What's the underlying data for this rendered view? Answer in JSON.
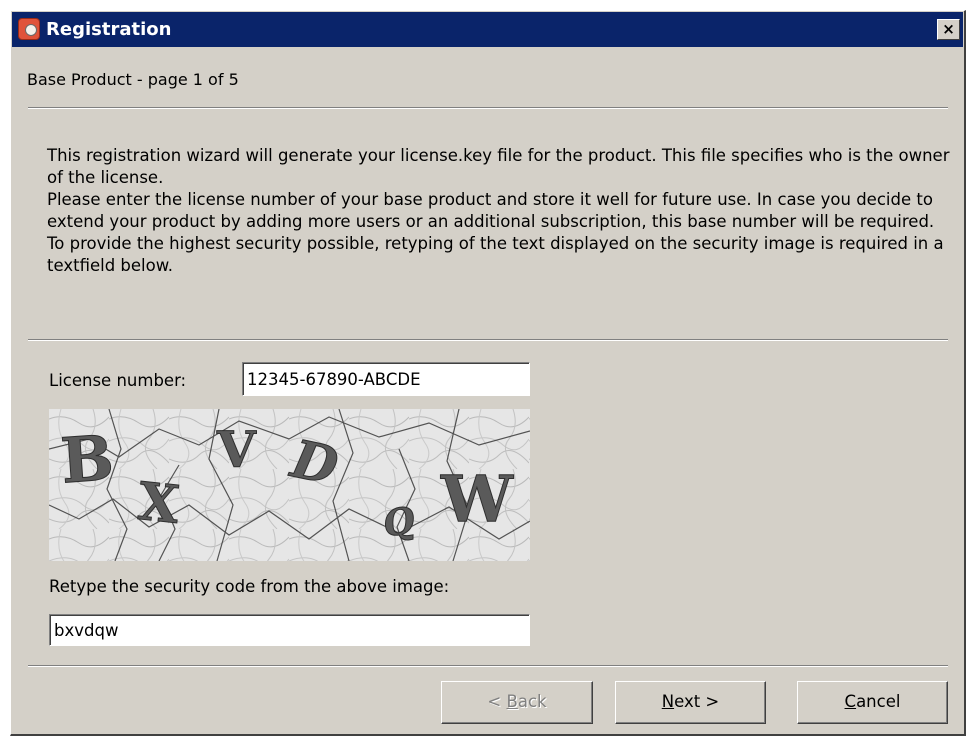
{
  "window": {
    "title": "Registration",
    "close_symbol": "×"
  },
  "page_header": "Base Product - page 1 of 5",
  "intro": {
    "paragraph_1": "This registration wizard will generate your license.key file for the product. This file specifies who is the owner of the license.",
    "paragraph_2": "Please enter the license number of your base product and store it well for future use. In case you decide to extend your product by adding more users or an additional subscription, this base number will be required.",
    "paragraph_3": "To provide the highest security possible, retyping of the text displayed on the security image is required in a textfield below."
  },
  "license": {
    "label": "License number:",
    "value": "12345-67890-ABCDE"
  },
  "captcha": {
    "letters": [
      "B",
      "X",
      "V",
      "D",
      "Q",
      "W"
    ]
  },
  "security_code": {
    "label": "Retype the security code from the above image:",
    "value": "bxvdqw"
  },
  "buttons": {
    "back_mnemonic_prefix": "< ",
    "back_mnemonic": "B",
    "back_rest": "ack",
    "next_mnemonic": "N",
    "next_rest": "ext >",
    "cancel_mnemonic": "C",
    "cancel_rest": "ancel",
    "back_enabled": false
  },
  "colors": {
    "titlebar": "#0a246a",
    "dialog_bg": "#d4d0c8",
    "app_icon": "#e0533a"
  },
  "icons": {
    "app": "registration-app-icon",
    "close": "close-icon"
  }
}
